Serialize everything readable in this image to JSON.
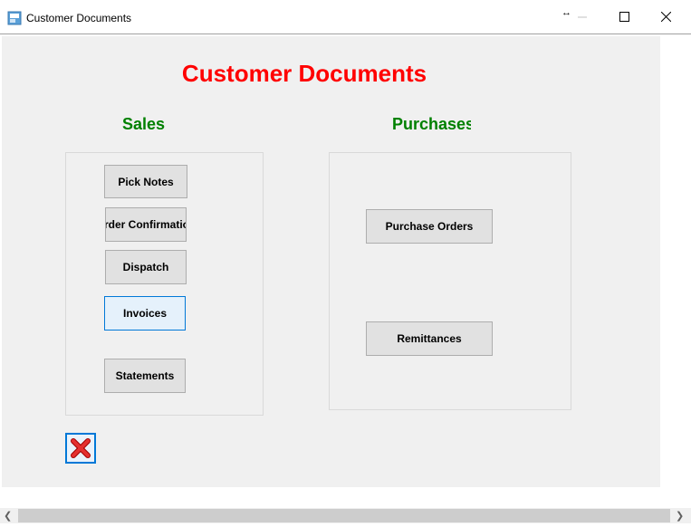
{
  "window": {
    "title": "Customer Documents",
    "resize_glyph": "↔"
  },
  "form": {
    "heading": "Customer Documents",
    "sales": {
      "heading": "Sales",
      "buttons": [
        "Pick Notes",
        "Order Confirmation",
        "Dispatch",
        "Invoices",
        "Statements"
      ]
    },
    "purchases": {
      "heading": "Purchases",
      "buttons": [
        "Purchase Orders",
        "Remittances"
      ]
    }
  },
  "icons": {
    "app": "app-window-icon",
    "exit": "red-x-close-icon"
  },
  "colors": {
    "heading": "#ff0000",
    "section": "#008000",
    "focus": "#0078d7"
  }
}
